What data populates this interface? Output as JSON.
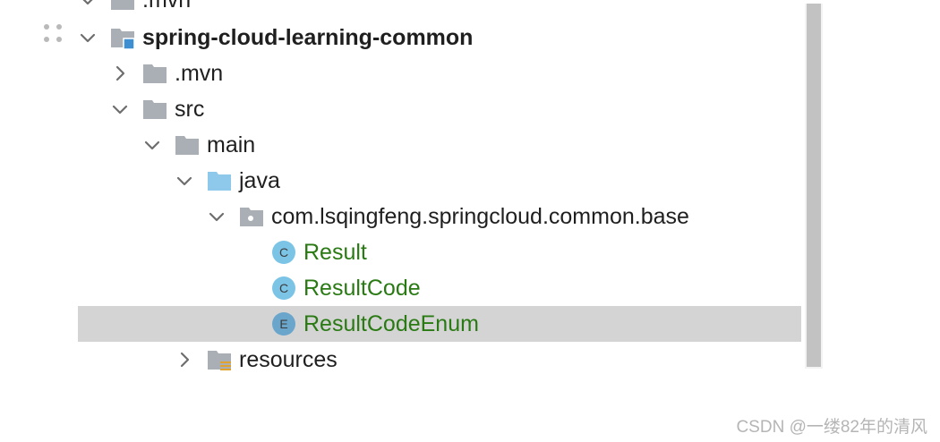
{
  "tree": {
    "items": [
      {
        "label": ".mvn",
        "icon": "folder-icon"
      },
      {
        "label": "spring-cloud-learning-common",
        "icon": "module-folder-icon"
      },
      {
        "label": ".mvn",
        "icon": "folder-icon"
      },
      {
        "label": "src",
        "icon": "folder-icon"
      },
      {
        "label": "main",
        "icon": "folder-icon"
      },
      {
        "label": "java",
        "icon": "source-folder-icon"
      },
      {
        "label": "com.lsqingfeng.springcloud.common.base",
        "icon": "package-icon"
      },
      {
        "label": "Result",
        "icon": "class-icon",
        "badge": "C"
      },
      {
        "label": "ResultCode",
        "icon": "class-icon",
        "badge": "C"
      },
      {
        "label": "ResultCodeEnum",
        "icon": "enum-icon",
        "badge": "E"
      },
      {
        "label": "resources",
        "icon": "resources-folder-icon"
      }
    ]
  },
  "colors": {
    "selected_row": "#d4d4d4",
    "vcs_added_text": "#2a7a14",
    "folder_gray": "#9aa0a6",
    "source_folder_blue": "#8ec9ec",
    "class_badge": "#7cc4e6"
  },
  "watermark": "CSDN @一缕82年的清风"
}
